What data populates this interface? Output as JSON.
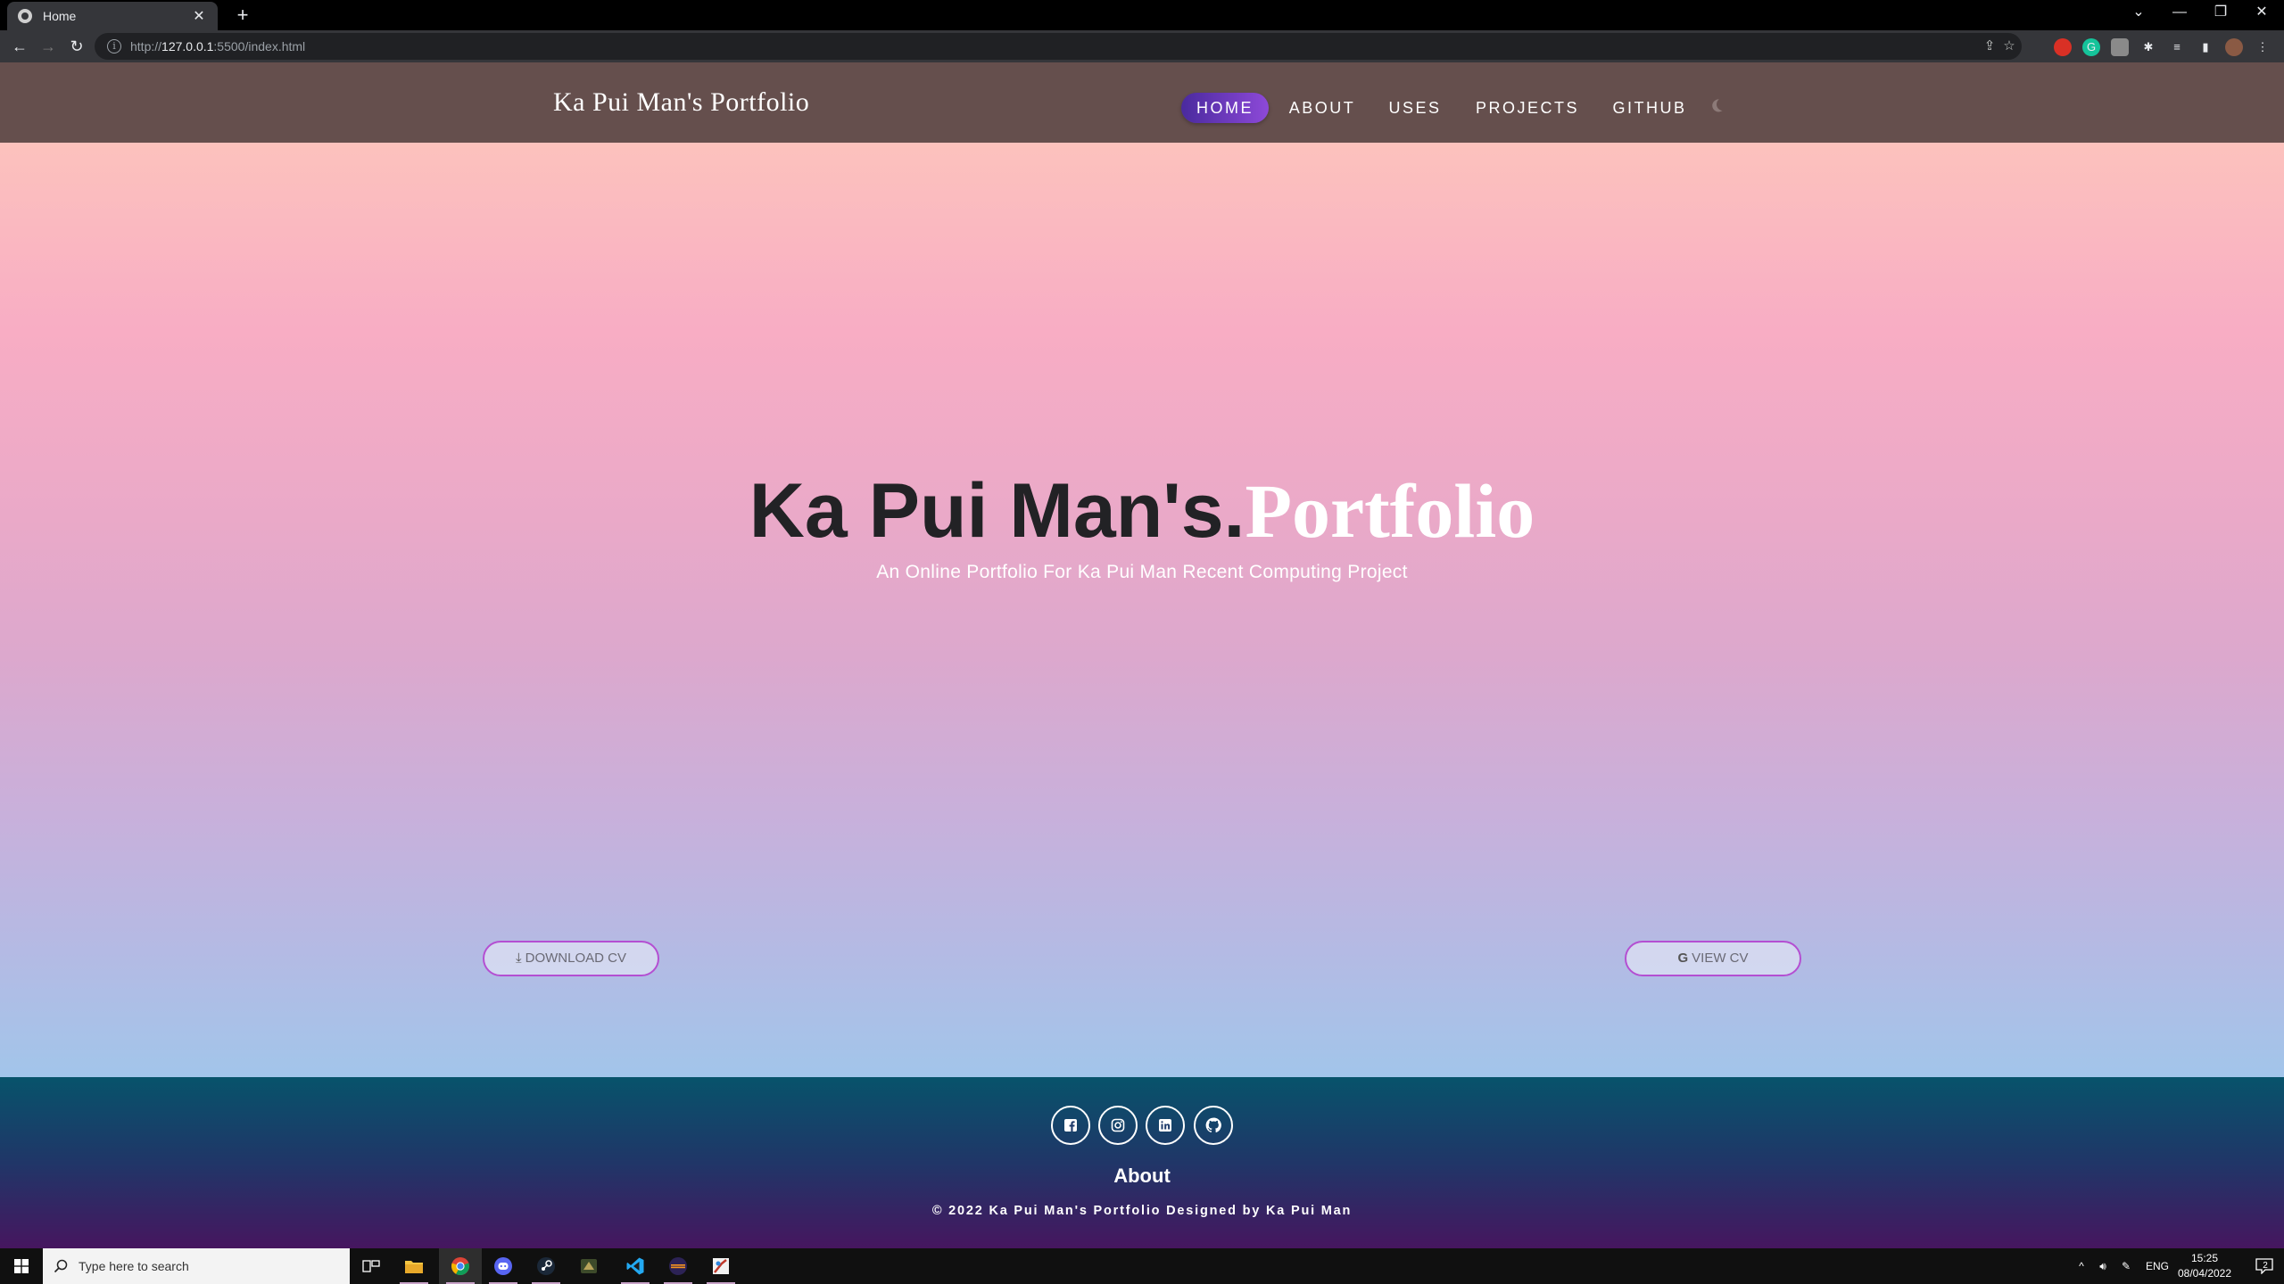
{
  "browser": {
    "tab_title": "Home",
    "url_prefix": "http://",
    "url_host": "127.0.0.1",
    "url_rest": ":5500/index.html"
  },
  "site": {
    "brand": "Ka Pui Man's Portfolio",
    "nav": [
      "HOME",
      "ABOUT",
      "USES",
      "PROJECTS",
      "GITHUB"
    ],
    "active_nav": "HOME",
    "accent_color": "#7a3fcf"
  },
  "hero": {
    "title_main": "Ka Pui Man's.",
    "title_accent": "Portfolio",
    "subtitle": "An Online Portfolio For Ka Pui Man Recent Computing Project",
    "download_cv": "DOWNLOAD CV",
    "view_cv": "VIEW CV"
  },
  "footer": {
    "social_icons": [
      "facebook-icon",
      "instagram-icon",
      "linkedin-icon",
      "github-icon"
    ],
    "about": "About",
    "copyright": "© 2022 Ka Pui Man's Portfolio Designed by Ka Pui Man"
  },
  "taskbar": {
    "search_placeholder": "Type here to search",
    "language": "ENG",
    "time": "15:25",
    "date": "08/04/2022",
    "notification_count": "2"
  }
}
